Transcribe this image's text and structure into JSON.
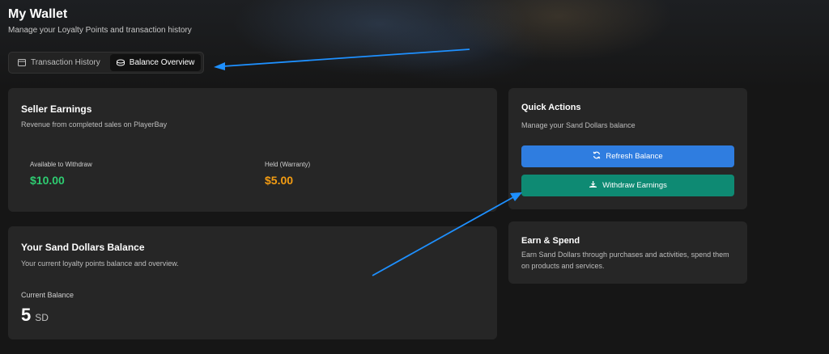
{
  "header": {
    "title": "My Wallet",
    "subtitle": "Manage your Loyalty Points and transaction history"
  },
  "tabs": [
    {
      "label": "Transaction History",
      "icon": "history-icon",
      "active": false
    },
    {
      "label": "Balance Overview",
      "icon": "coins-icon",
      "active": true
    }
  ],
  "seller_earnings": {
    "title": "Seller Earnings",
    "description": "Revenue from completed sales on PlayerBay",
    "available_label": "Available to Withdraw",
    "available_value": "$10.00",
    "held_label": "Held (Warranty)",
    "held_value": "$5.00"
  },
  "sand_dollars": {
    "title": "Your Sand Dollars Balance",
    "description": "Your current loyalty points balance and overview.",
    "current_label": "Current Balance",
    "current_value": "5",
    "unit": "SD"
  },
  "quick_actions": {
    "title": "Quick Actions",
    "description": "Manage your Sand Dollars balance",
    "refresh_label": "Refresh Balance",
    "withdraw_label": "Withdraw Earnings"
  },
  "earn_spend": {
    "title": "Earn & Spend",
    "description": "Earn Sand Dollars through purchases and activities, spend them on products and services."
  },
  "colors": {
    "available": "#2ecc71",
    "held": "#f39c12",
    "refresh_button": "#2f7de0",
    "withdraw_button": "#0e8a73",
    "annotation_arrow": "#1e90ff"
  }
}
